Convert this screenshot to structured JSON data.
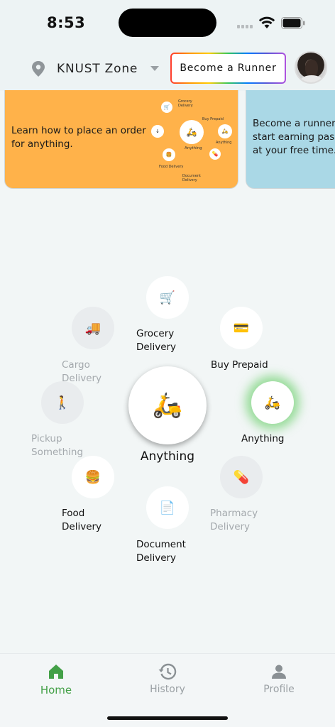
{
  "status_bar": {
    "time": "8:53"
  },
  "header": {
    "location": "KNUST Zone",
    "runner_button": "Become a Runner"
  },
  "cards": [
    {
      "text": "Learn how to place an order for anything.",
      "diagram_labels": {
        "grocery": "Grocery Delivery",
        "prepaid": "Buy Prepaid",
        "anything_small": "Anything",
        "anything_center": "Anything",
        "food": "Food Delivery",
        "document": "Document Delivery"
      }
    },
    {
      "text": "Become a runner t\nstart earning pass\nat your free time."
    }
  ],
  "services": {
    "center_label": "Anything",
    "grocery": "Grocery\nDelivery",
    "prepaid": "Buy Prepaid",
    "cargo": "Cargo\nDelivery",
    "anything": "Anything",
    "pickup": "Pickup\nSomething",
    "food": "Food\nDelivery",
    "pharmacy": "Pharmacy\nDelivery",
    "document": "Document\nDelivery"
  },
  "icons": {
    "center": "🛵",
    "grocery": "🛒",
    "prepaid": "💳",
    "cargo": "🚚",
    "anything": "🛵",
    "pickup": "🚶",
    "food": "🍔",
    "pharmacy": "💊",
    "document": "📄"
  },
  "bottom_nav": {
    "home": "Home",
    "history": "History",
    "profile": "Profile"
  },
  "colors": {
    "accent_green": "#43a047",
    "card_orange": "#ffb24a",
    "card_blue": "#aad8e6"
  }
}
